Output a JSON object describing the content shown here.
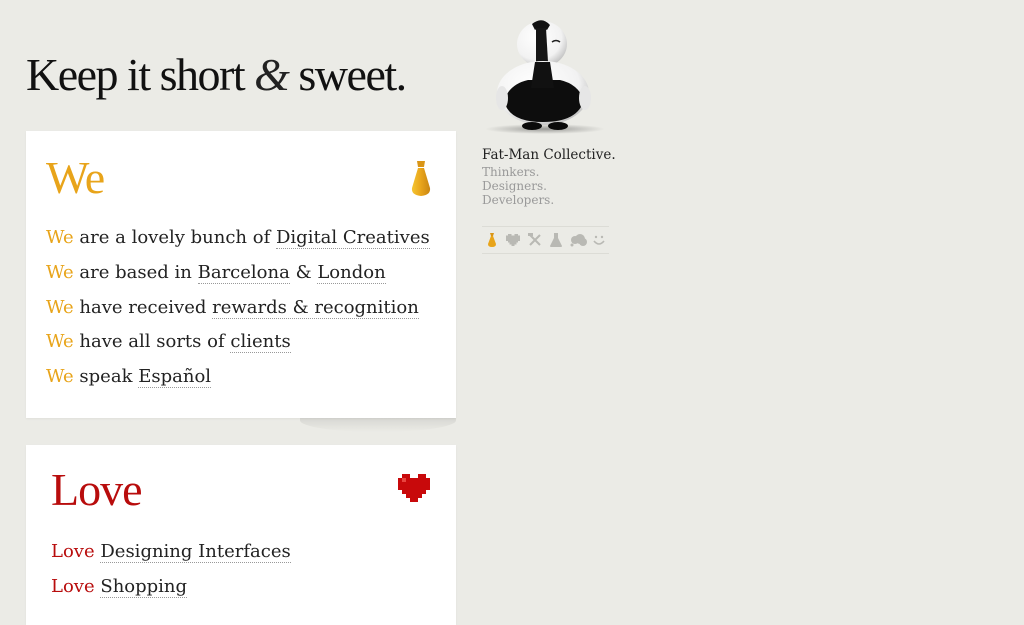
{
  "headline": {
    "part1": "Keep it short",
    "amp": "&",
    "part2": "sweet."
  },
  "colors": {
    "we_accent": "#e8a41a",
    "love_accent": "#b80c0c",
    "background": "#ebebe6"
  },
  "we_card": {
    "title": "We",
    "icon": "tie-icon",
    "items": [
      {
        "keyword": "We",
        "before": "are a lovely bunch of",
        "link1": "Digital Creatives",
        "joiner": "",
        "link2": ""
      },
      {
        "keyword": "We",
        "before": "are based in",
        "link1": "Barcelona",
        "joiner": "&",
        "link2": "London"
      },
      {
        "keyword": "We",
        "before": "have received",
        "link1": "rewards & recognition",
        "joiner": "",
        "link2": ""
      },
      {
        "keyword": "We",
        "before": "have all sorts of",
        "link1": "clients",
        "joiner": "",
        "link2": ""
      },
      {
        "keyword": "We",
        "before": "speak",
        "link1": "Español",
        "joiner": "",
        "link2": ""
      }
    ]
  },
  "love_card": {
    "title": "Love",
    "icon": "heart-icon",
    "items": [
      {
        "keyword": "Love",
        "link1": "Designing Interfaces"
      },
      {
        "keyword": "Love",
        "link1": "Shopping"
      }
    ]
  },
  "collective": {
    "name": "Fat-Man Collective.",
    "roles": [
      "Thinkers.",
      "Designers.",
      "Developers."
    ]
  },
  "icon_bar": [
    "tie-icon",
    "heart-icon",
    "tools-icon",
    "flask-icon",
    "thought-cloud-icon",
    "smiley-icon"
  ]
}
